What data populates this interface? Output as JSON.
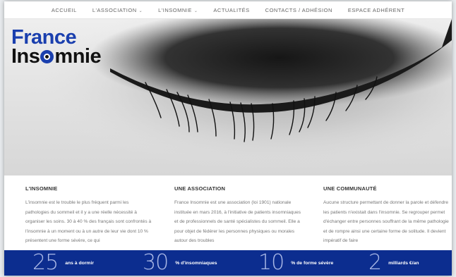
{
  "nav": {
    "items": [
      {
        "label": "ACCUEIL",
        "dropdown": false
      },
      {
        "label": "L'ASSOCIATION",
        "dropdown": true
      },
      {
        "label": "L'INSOMNIE",
        "dropdown": true
      },
      {
        "label": "ACTUALITÉS",
        "dropdown": false
      },
      {
        "label": "CONTACTS / ADHÉSION",
        "dropdown": false
      },
      {
        "label": "ESPACE ADHÉRENT",
        "dropdown": false
      }
    ],
    "caret_icon": "chevron-down-icon"
  },
  "logo": {
    "line1": "France",
    "line2_pre": "Ins",
    "line2_post": "mnie",
    "brand_color": "#1a3fae"
  },
  "columns": [
    {
      "title": "L'INSOMNIE",
      "text": "L'insomnie est le trouble le plus fréquent parmi les pathologies du sommeil et il y a une réelle nécessité à organiser les soins. 30 à 40 % des français sont confrontés à l'insomnie à un moment ou à un autre de leur vie dont 10 % présentent une forme sévère, ce qui"
    },
    {
      "title": "UNE ASSOCIATION",
      "text": "France Insomnie est une association (loi 1901) nationale instituée en mars 2016, à l'initiative de patients insomniaques et de professionnels de santé spécialistes du sommeil. Elle a pour objet de fédérer les personnes physiques ou morales autour des troubles"
    },
    {
      "title": "UNE COMMUNAUTÉ",
      "text": "Aucune structure permettant de donner la parole et défendre les patients n'existait dans l'insomnie. Se regrouper permet d'échanger entre personnes souffrant de la même pathologie et de rompre ainsi une certaine forme de solitude. Il devient impératif de faire"
    }
  ],
  "stats": [
    {
      "number": "25",
      "label": "ans à dormir"
    },
    {
      "number": "30",
      "label": "% d'insomniaques"
    },
    {
      "number": "10",
      "label": "% de forme sévère"
    },
    {
      "number": "2",
      "label": "milliards €/an"
    }
  ],
  "colors": {
    "stats_bar": "#0c2d8f",
    "stat_number": "#aab8e6"
  }
}
